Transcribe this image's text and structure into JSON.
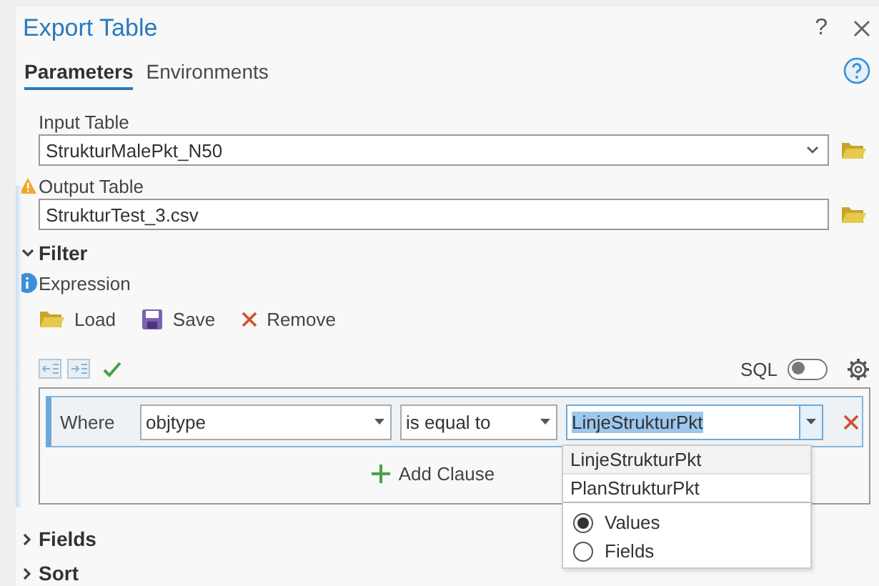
{
  "window": {
    "title": "Export Table",
    "help_glyph": "?"
  },
  "tabs": [
    {
      "label": "Parameters",
      "selected": true
    },
    {
      "label": "Environments",
      "selected": false
    }
  ],
  "parameters": [
    {
      "label": "Input Table",
      "value": "StrukturMalePkt_N50",
      "warning": false,
      "dropdown": true
    },
    {
      "label": "Output Table",
      "value": "StrukturTest_3.csv",
      "warning": true,
      "dropdown": false
    }
  ],
  "sections": [
    {
      "title": "Filter",
      "expanded": true
    },
    {
      "title": "Fields",
      "expanded": false
    },
    {
      "title": "Sort",
      "expanded": false
    }
  ],
  "filter": {
    "expression_label": "Expression",
    "actions": [
      {
        "kind": "load",
        "label": "Load"
      },
      {
        "kind": "save",
        "label": "Save"
      },
      {
        "kind": "remove",
        "label": "Remove"
      }
    ],
    "sql": {
      "label": "SQL",
      "on": false
    },
    "clause": {
      "where": "Where",
      "field": "objtype",
      "operator": "is equal to",
      "value": "LinjeStrukturPkt"
    },
    "add_clause": "Add Clause",
    "dropdown": {
      "options": [
        {
          "label": "LinjeStrukturPkt",
          "selected": true
        },
        {
          "label": "PlanStrukturPkt",
          "selected": false
        }
      ],
      "modes": [
        {
          "label": "Values",
          "selected": true
        },
        {
          "label": "Fields",
          "selected": false
        }
      ]
    }
  }
}
